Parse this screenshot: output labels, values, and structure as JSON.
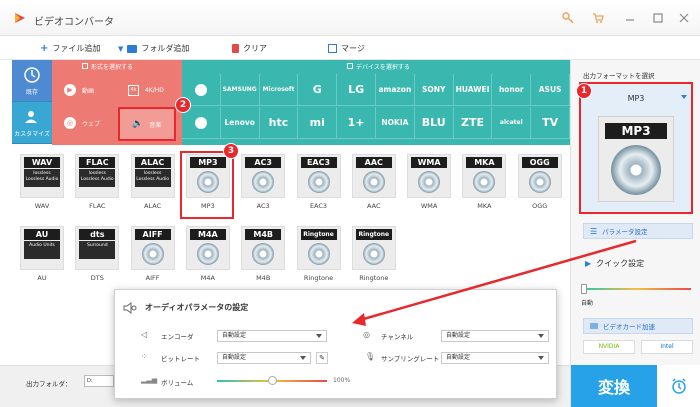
{
  "window": {
    "title": "ビデオコンバータ"
  },
  "toolbar": {
    "add_file": "ファイル追加",
    "add_folder": "フォルダ追加",
    "clear": "クリア",
    "merge": "マージ"
  },
  "left_tabs": [
    {
      "label": "既存"
    },
    {
      "label": "カスタマイズ"
    }
  ],
  "panels": {
    "category_header": "形式を選択する",
    "device_header": "デバイスを選択する"
  },
  "categories": {
    "video": "動画",
    "hd": "4K/HD",
    "web": "ウェブ",
    "audio": "音楽"
  },
  "devices": {
    "row1": [
      "",
      "SAMSUNG",
      "Microsoft",
      "G",
      "LG",
      "amazon",
      "SONY",
      "HUAWEI",
      "honor",
      "ASUS"
    ],
    "row2": [
      "",
      "Lenovo",
      "htc",
      "mi",
      "1+",
      "NOKIA",
      "BLU",
      "ZTE",
      "alcatel",
      "TV"
    ]
  },
  "formats": [
    {
      "tag": "WAV",
      "sub": "lossless Lossless Audio",
      "label": "WAV"
    },
    {
      "tag": "FLAC",
      "sub": "lossless Lossless Audio",
      "label": "FLAC"
    },
    {
      "tag": "ALAC",
      "sub": "lossless Lossless Audio",
      "label": "ALAC"
    },
    {
      "tag": "MP3",
      "sub": "",
      "label": "MP3"
    },
    {
      "tag": "AC3",
      "sub": "",
      "label": "AC3"
    },
    {
      "tag": "EAC3",
      "sub": "",
      "label": "EAC3"
    },
    {
      "tag": "AAC",
      "sub": "",
      "label": "AAC"
    },
    {
      "tag": "WMA",
      "sub": "",
      "label": "WMA"
    },
    {
      "tag": "MKA",
      "sub": "",
      "label": "MKA"
    },
    {
      "tag": "OGG",
      "sub": "",
      "label": "OGG"
    },
    {
      "tag": "AU",
      "sub": "Audio Units",
      "label": "AU"
    },
    {
      "tag": "dts",
      "sub": "Surround",
      "label": "DTS"
    },
    {
      "tag": "AIFF",
      "sub": "",
      "label": "AIFF"
    },
    {
      "tag": "M4A",
      "sub": "",
      "label": "M4A"
    },
    {
      "tag": "M4B",
      "sub": "",
      "label": "M4B"
    },
    {
      "tag": "Ringtone",
      "sub": "",
      "label": "Ringtone"
    },
    {
      "tag": "Ringtone",
      "sub": "",
      "label": "Ringtone"
    }
  ],
  "right_panel": {
    "output_format_label": "出力フォーマットを選択",
    "selected_format": "MP3",
    "preview_tag": "MP3",
    "param_button": "パラメータ設定",
    "quick_settings": "クイック設定",
    "quality_auto": "自動",
    "gpu_label": "ビデオカード加速",
    "gpu_nvidia": "NVIDIA",
    "gpu_intel": "Intel",
    "convert": "変換"
  },
  "bottom": {
    "output_folder_label": "出力フォルダ：",
    "output_folder_value": "D:¥WFMag"
  },
  "dialog": {
    "title": "オーディオパラメータの設定",
    "encoder_label": "エンコーダ",
    "encoder_value": "自動設定",
    "channel_label": "チャンネル",
    "channel_value": "自動設定",
    "bitrate_label": "ビットレート",
    "bitrate_value": "自動設定",
    "samplerate_label": "サンプリングレート",
    "samplerate_value": "自動設定",
    "volume_label": "ボリューム",
    "volume_value": "100%",
    "volume_level": 0.5
  },
  "annotations": {
    "step1": "1",
    "step2": "2",
    "step3": "3"
  },
  "colors": {
    "accent_blue": "#38a7d4",
    "category_red": "#ee7a74",
    "device_teal": "#3ab8b0",
    "highlight_red": "#e8282c"
  }
}
